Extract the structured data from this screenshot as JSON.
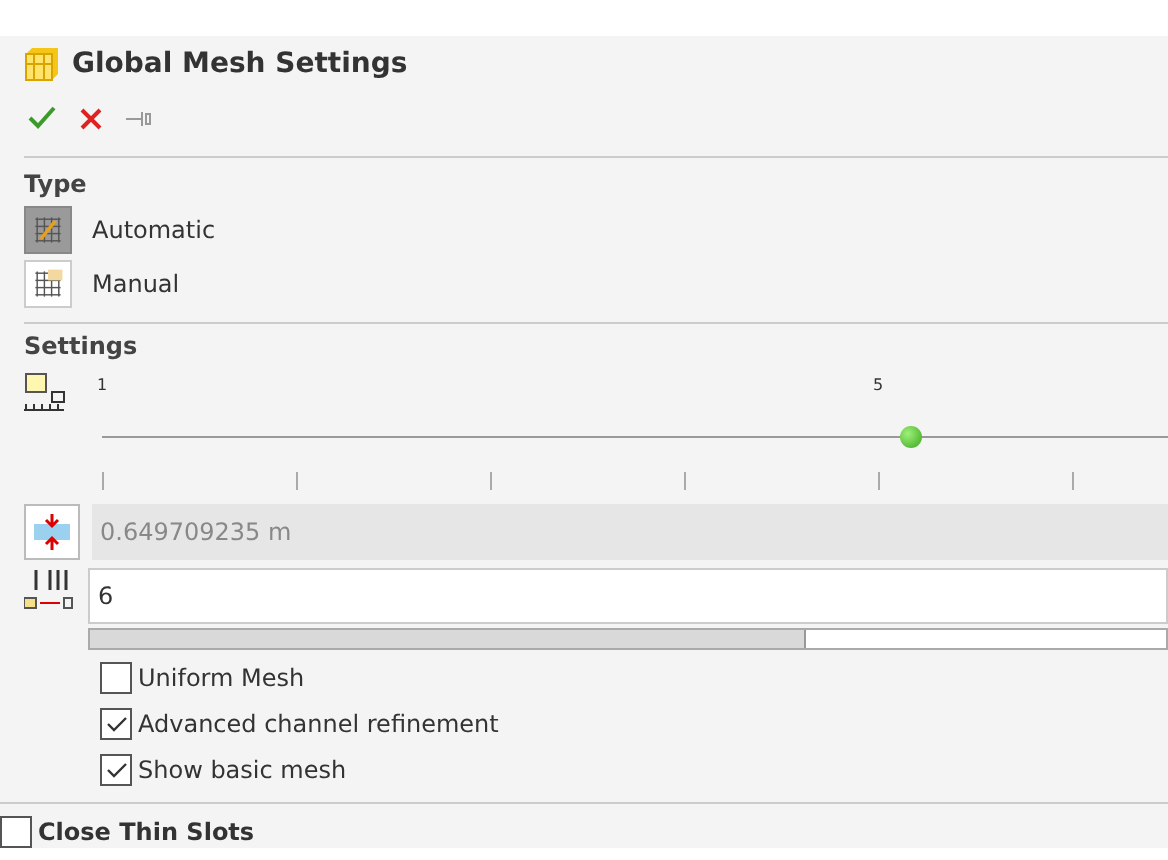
{
  "panel": {
    "title": "Global Mesh Settings"
  },
  "toolbar": [
    {
      "kind": "ok"
    },
    {
      "kind": "cancel"
    },
    {
      "kind": "pin"
    }
  ],
  "type_section": {
    "heading": "Type",
    "options": [
      {
        "label": "Automatic",
        "kind": "automatic",
        "selected": true
      },
      {
        "label": "Manual",
        "kind": "manual",
        "selected": false
      }
    ]
  },
  "settings_section": {
    "heading": "Settings",
    "slider": {
      "labels": [
        "1",
        "5"
      ],
      "level": 0.73
    },
    "gap_field": {
      "value": "0.649709235 m",
      "disabled": true
    },
    "cells_field": {
      "value": "6",
      "level": 0.665
    },
    "options": [
      {
        "label": "Uniform Mesh",
        "checked": false
      },
      {
        "label": "Advanced channel refinement",
        "checked": true
      },
      {
        "label": "Show basic mesh",
        "checked": true
      }
    ]
  },
  "close_thin_slots": {
    "label": "Close Thin Slots",
    "checked": false
  }
}
